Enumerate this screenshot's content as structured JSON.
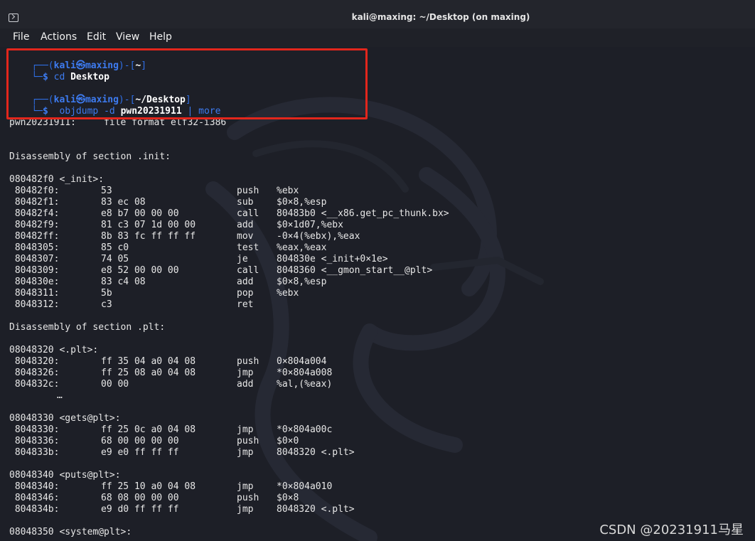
{
  "window": {
    "title": "kali@maxing: ~/Desktop (on maxing)"
  },
  "menu": [
    "File",
    "Actions",
    "Edit",
    "View",
    "Help"
  ],
  "prompt1": {
    "user": "kali",
    "sep": "㉿",
    "host": "maxing",
    "path": "~",
    "command": "cd",
    "argument": "Desktop"
  },
  "prompt2": {
    "user": "kali",
    "sep": "㉿",
    "host": "maxing",
    "path": "~/Desktop",
    "command": "objdump",
    "flag": "-d",
    "argument": "pwn20231911",
    "pipe": "|",
    "pipe_command": "more"
  },
  "file_format_line": "pwn20231911:     file format elf32-i386",
  "sections": [
    {
      "header": "Disassembly of section .init:",
      "blocks": [
        {
          "label": "080482f0 <_init>:",
          "rows": [
            {
              "addr": " 80482f0:",
              "bytes": "53",
              "op": "push",
              "args": "%ebx"
            },
            {
              "addr": " 80482f1:",
              "bytes": "83 ec 08",
              "op": "sub",
              "args": "$0×8,%esp"
            },
            {
              "addr": " 80482f4:",
              "bytes": "e8 b7 00 00 00",
              "op": "call",
              "args": "80483b0 <__x86.get_pc_thunk.bx>"
            },
            {
              "addr": " 80482f9:",
              "bytes": "81 c3 07 1d 00 00",
              "op": "add",
              "args": "$0×1d07,%ebx"
            },
            {
              "addr": " 80482ff:",
              "bytes": "8b 83 fc ff ff ff",
              "op": "mov",
              "args": "-0×4(%ebx),%eax"
            },
            {
              "addr": " 8048305:",
              "bytes": "85 c0",
              "op": "test",
              "args": "%eax,%eax"
            },
            {
              "addr": " 8048307:",
              "bytes": "74 05",
              "op": "je",
              "args": "804830e <_init+0×1e>"
            },
            {
              "addr": " 8048309:",
              "bytes": "e8 52 00 00 00",
              "op": "call",
              "args": "8048360 <__gmon_start__@plt>"
            },
            {
              "addr": " 804830e:",
              "bytes": "83 c4 08",
              "op": "add",
              "args": "$0×8,%esp"
            },
            {
              "addr": " 8048311:",
              "bytes": "5b",
              "op": "pop",
              "args": "%ebx"
            },
            {
              "addr": " 8048312:",
              "bytes": "c3",
              "op": "ret",
              "args": ""
            }
          ]
        }
      ]
    },
    {
      "header": "Disassembly of section .plt:",
      "blocks": [
        {
          "label": "08048320 <.plt>:",
          "rows": [
            {
              "addr": " 8048320:",
              "bytes": "ff 35 04 a0 04 08",
              "op": "push",
              "args": "0×804a004"
            },
            {
              "addr": " 8048326:",
              "bytes": "ff 25 08 a0 04 08",
              "op": "jmp",
              "args": "*0×804a008"
            },
            {
              "addr": " 804832c:",
              "bytes": "00 00",
              "op": "add",
              "args": "%al,(%eax)"
            }
          ],
          "ellipsis": "…"
        },
        {
          "label": "08048330 <gets@plt>:",
          "rows": [
            {
              "addr": " 8048330:",
              "bytes": "ff 25 0c a0 04 08",
              "op": "jmp",
              "args": "*0×804a00c"
            },
            {
              "addr": " 8048336:",
              "bytes": "68 00 00 00 00",
              "op": "push",
              "args": "$0×0"
            },
            {
              "addr": " 804833b:",
              "bytes": "e9 e0 ff ff ff",
              "op": "jmp",
              "args": "8048320 <.plt>"
            }
          ]
        },
        {
          "label": "08048340 <puts@plt>:",
          "rows": [
            {
              "addr": " 8048340:",
              "bytes": "ff 25 10 a0 04 08",
              "op": "jmp",
              "args": "*0×804a010"
            },
            {
              "addr": " 8048346:",
              "bytes": "68 08 00 00 00",
              "op": "push",
              "args": "$0×8"
            },
            {
              "addr": " 804834b:",
              "bytes": "e9 d0 ff ff ff",
              "op": "jmp",
              "args": "8048320 <.plt>"
            }
          ]
        },
        {
          "label": "08048350 <system@plt>:",
          "rows": []
        }
      ]
    }
  ],
  "watermark": "CSDN @20231911马星",
  "colors": {
    "prompt_blue": "#2f6fe6",
    "highlight_red": "#e2261c",
    "background": "#1d1f27"
  }
}
